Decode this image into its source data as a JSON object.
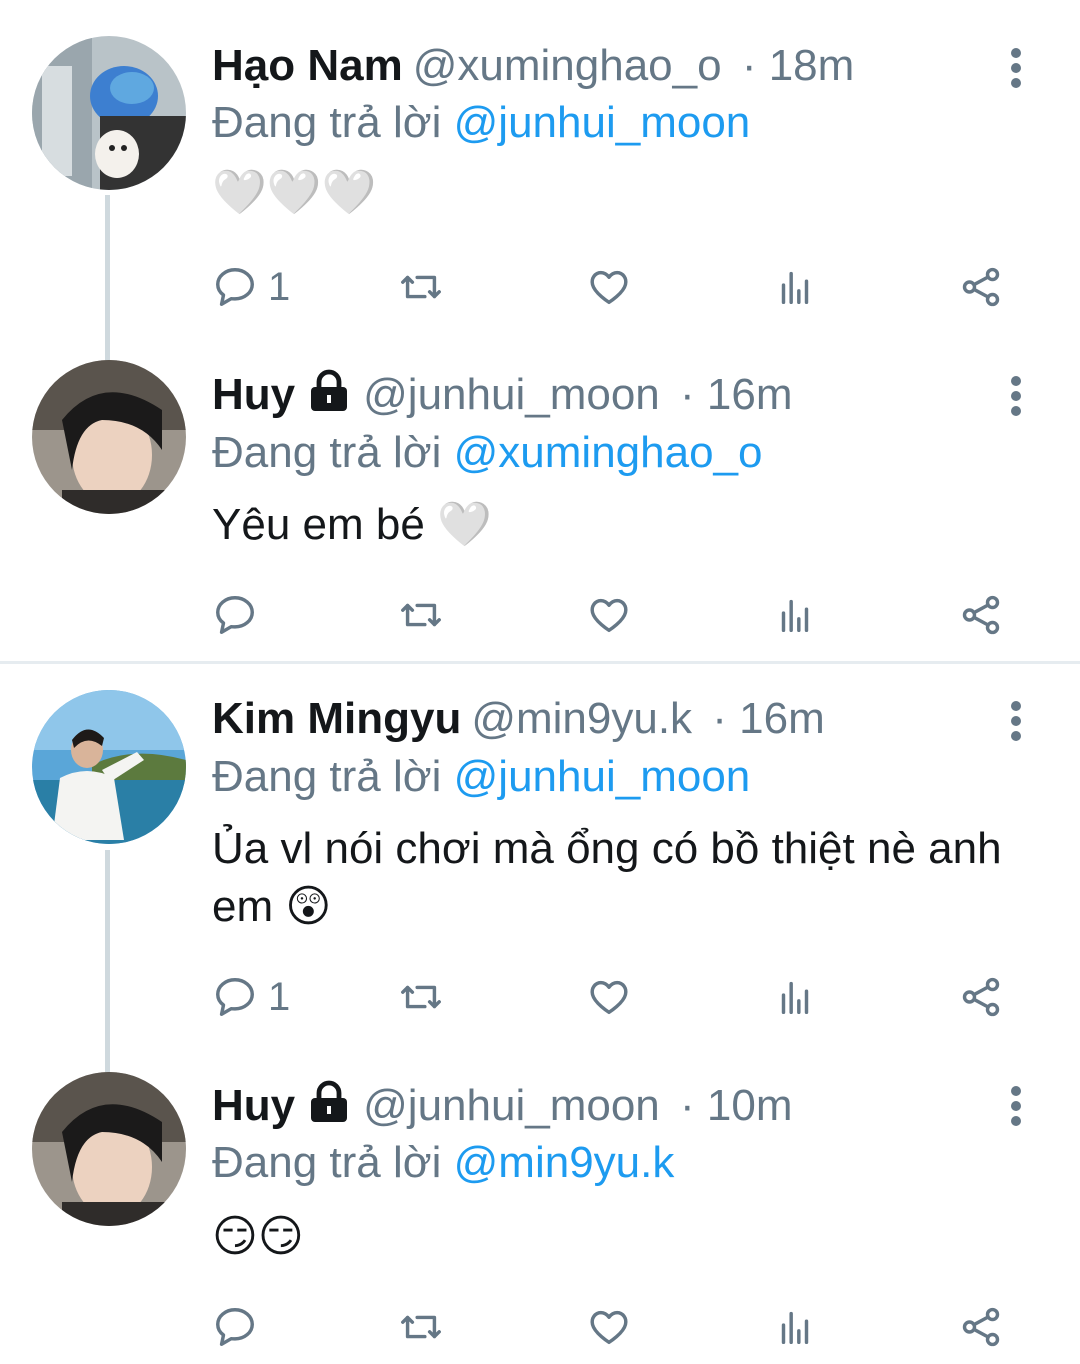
{
  "tweets": [
    {
      "name": "Hạo Nam",
      "handle": "@xuminghao_o",
      "time": "· 18m",
      "reply_prefix": "Đang trả lời",
      "reply_to": "@junhui_moon",
      "text": "🤍🤍🤍",
      "reply_count": "1",
      "locked": false
    },
    {
      "name": "Huy",
      "handle": "@junhui_moon",
      "time": "· 16m",
      "reply_prefix": "Đang trả lời",
      "reply_to": "@xuminghao_o",
      "text": "Yêu em bé 🤍",
      "reply_count": "",
      "locked": true
    },
    {
      "name": "Kim Mingyu",
      "handle": "@min9yu.k",
      "time": "· 16m",
      "reply_prefix": "Đang trả lời",
      "reply_to": "@junhui_moon",
      "text": "Ủa vl nói chơi mà ổng có bồ thiệt nè anh em 😲",
      "reply_count": "1",
      "locked": false
    },
    {
      "name": "Huy",
      "handle": "@junhui_moon",
      "time": "· 10m",
      "reply_prefix": "Đang trả lời",
      "reply_to": "@min9yu.k",
      "text": "😏😏",
      "reply_count": "",
      "locked": true
    }
  ],
  "icons": {
    "reply": "speech-bubble-icon",
    "retweet": "retweet-icon",
    "like": "heart-icon",
    "views": "analytics-bars-icon",
    "share": "share-icon",
    "more": "vertical-dots-icon",
    "lock": "lock-icon"
  },
  "colors": {
    "mention": "#1d9bf0",
    "secondary_text": "#657786",
    "thread_line": "#cfd9de"
  }
}
